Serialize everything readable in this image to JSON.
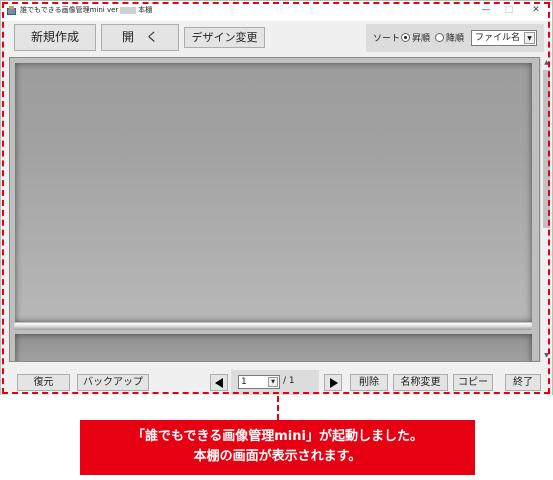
{
  "window": {
    "title": "誰でもできる画像管理mini ver",
    "title_suffix": "本棚",
    "controls": {
      "minimize": "—",
      "maximize": "□",
      "close": "✕"
    }
  },
  "toolbar": {
    "new_label": "新規作成",
    "open_label": "開　く",
    "design_label": "デザイン変更",
    "sort": {
      "label": "ソート",
      "asc_label": "昇順",
      "desc_label": "降順",
      "selected_order": "asc",
      "select_value": "ファイル名"
    }
  },
  "bottom": {
    "restore_label": "復元",
    "backup_label": "バックアップ",
    "page_value": "1",
    "page_total": "/ 1",
    "delete_label": "削除",
    "rename_label": "名称変更",
    "copy_label": "コピー",
    "exit_label": "終了"
  },
  "callout": {
    "line1": "「誰でもできる画像管理mini」が起動しました。",
    "line2": "本棚の画面が表示されます。"
  },
  "colors": {
    "accent": "#e60012",
    "window_bg": "#f0f0f0",
    "shelf": "#a8a8a8"
  },
  "icons": {
    "prev": "triangle-left-icon",
    "next": "triangle-right-icon",
    "dropdown": "chevron-down-icon"
  }
}
